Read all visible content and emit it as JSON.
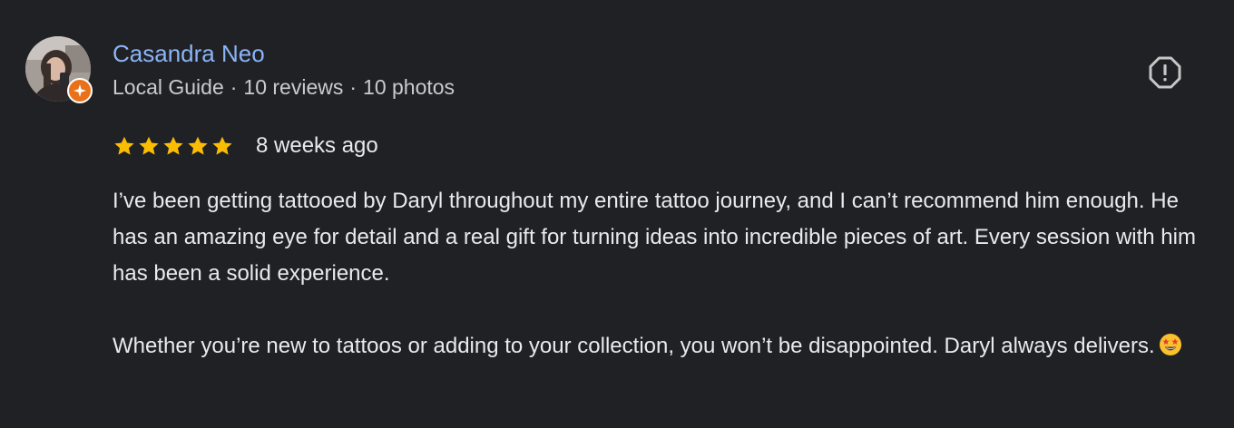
{
  "author": {
    "name": "Casandra Neo",
    "guide_label": "Local Guide",
    "separator": "·",
    "reviews": "10 reviews",
    "photos": "10 photos"
  },
  "rating": {
    "stars": 5,
    "max": 5,
    "star_color": "#fbbc04",
    "date": "8 weeks ago"
  },
  "review": {
    "paragraphs": [
      "I’ve been getting tattooed by Daryl throughout my entire tattoo journey, and I can’t recommend him enough. He has an amazing eye for detail and a real gift for turning ideas into incredible pieces of art. Every session with him has been a solid experience.",
      "Whether you’re new to tattoos or adding to your collection, you won’t be disappointed. Daryl always delivers."
    ],
    "trailing_emoji": "star-struck-emoji"
  },
  "icons": {
    "avatar": "profile-photo",
    "badge": "local-guide-badge-icon",
    "report": "report-icon"
  },
  "colors": {
    "background": "#202124",
    "author_name": "#8ab4f8",
    "text": "#e8eaed",
    "guide_badge": "#e8711a"
  }
}
